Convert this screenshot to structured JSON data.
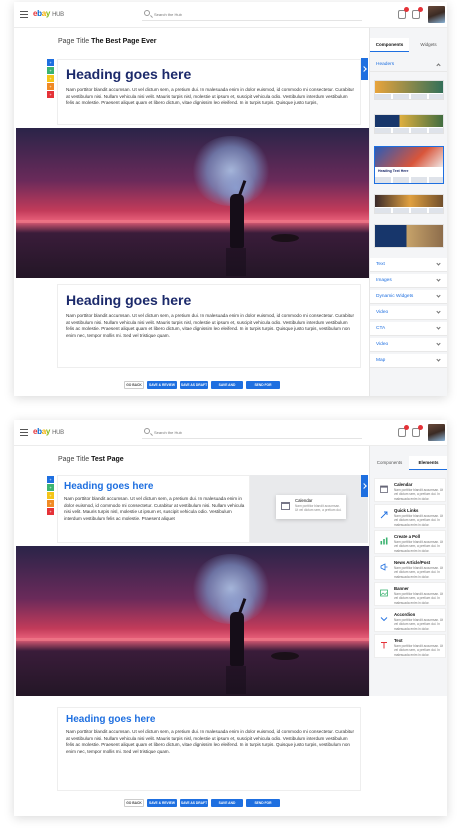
{
  "app": {
    "logo_letters": [
      "e",
      "b",
      "a",
      "y"
    ],
    "logo_suffix": "HUB",
    "search_placeholder": "Search the Hub"
  },
  "screen1": {
    "page_title_prefix": "Page Title",
    "page_title": "The Best Page Ever",
    "heading1": "Heading goes here",
    "para1": "Nam porttitor blandit accumsan. Ut vel dictum sem, a pretium dui. In malesuada enim in dolor euismod, id commodo mi consectetur. Curabitur at vestibulum nisi. Nullam vehicula nisi velit. Mauris turpis nisl, molestie ut ipsum et, suscipit vehicula odio. Vestibulum interdum vestibulum felis ac molestie. Praesent aliquet quam et libero dictum, vitae dignissim leo eleifend. In in turpis turpis. Quisque justo turpis,",
    "heading2": "Heading goes here",
    "para2": "Nam porttitor blandit accumsan. Ut vel dictum sem, a pretium dui. In malesuada enim in dolor euismod, id commodo mi consectetur. Curabitur at vestibulum nisi. Nullam vehicula nisi velit. Mauris turpis nisl, molestie ut ipsum et, suscipit vehicula odio. Vestibulum interdum vestibulum felis ac molestie. Praesent aliquet quam et libero dictum, vitae dignissim leo eleifend. In in turpis turpis. Quisque justo turpis, vestibulum non enim nec, tempor mollis mi. Sed vel tristique quam.",
    "sidebar": {
      "tab_components": "Components",
      "tab_widgets": "Widgets",
      "headers_label": "Headers",
      "thumb_caption": "Heading Text Here",
      "sections": [
        "Text",
        "Images",
        "Dynamic Widgets",
        "Video",
        "CTA",
        "Video",
        "Map"
      ]
    }
  },
  "screen2": {
    "page_title_prefix": "Page Title",
    "page_title": "Test Page",
    "heading1": "Heading goes here",
    "para1": "Nam porttitor blandit accumsan. Ut vel dictum sem, a pretium dui. In malesuada enim in dolor euismod, id commodo mi consectetur. Curabitur at vestibulum nisi. Nullam vehicula nisi velit. Mauris turpis nisl, molestie ut ipsum et, suscipit vehicula odio. Vestibulum interdum vestibulum felis ac molestie. Praesent aliquet",
    "drag_card_title": "Calendar",
    "drag_card_desc": "Nam porttitor blandit accumsan. Ut vel dictum sem, a pretium dui.",
    "heading2": "Heading goes here",
    "para2": "Nam porttitor blandit accumsan. Ut vel dictum sem, a pretium dui. In malesuada enim in dolor euismod, id commodo mi consectetur. Curabitur at vestibulum nisi. Nullam vehicula nisi velit. Mauris turpis nisl, molestie ut ipsum et, suscipit vehicula odio. Vestibulum interdum vestibulum felis ac molestie. Praesent aliquet quam et libero dictum, vitae dignissim leo eleifend. In in turpis turpis. Quisque justo turpis, vestibulum non enim nec, tempor mollis mi. Sed vel tristique quam.",
    "sidebar": {
      "tab_components": "Components",
      "tab_elements": "Elements",
      "items": [
        {
          "title": "Calendar",
          "desc": "Nam porttitor blandit accumsan. Ut vel dictum sem, a pretium dui. In malesuada enim in dolor.",
          "icon": "calendar-icon"
        },
        {
          "title": "Quick Links",
          "desc": "Nam porttitor blandit accumsan. Ut vel dictum sem, a pretium dui. In malesuada enim in dolor.",
          "icon": "link-icon"
        },
        {
          "title": "Create a Poll",
          "desc": "Nam porttitor blandit accumsan. Ut vel dictum sem, a pretium dui. In malesuada enim in dolor.",
          "icon": "poll-icon"
        },
        {
          "title": "News Article/Post",
          "desc": "Nam porttitor blandit accumsan. Ut vel dictum sem, a pretium dui. In malesuada enim in dolor.",
          "icon": "megaphone-icon"
        },
        {
          "title": "Banner",
          "desc": "Nam porttitor blandit accumsan. Ut vel dictum sem, a pretium dui. In malesuada enim in dolor.",
          "icon": "banner-icon"
        },
        {
          "title": "Accordion",
          "desc": "Nam porttitor blandit accumsan. Ut vel dictum sem, a pretium dui. In malesuada enim in dolor.",
          "icon": "accordion-icon"
        },
        {
          "title": "Text",
          "desc": "Nam porttitor blandit accumsan. Ut vel dictum sem, a pretium dui. In malesuada enim in dolor.",
          "icon": "text-icon"
        }
      ]
    }
  },
  "buttons": {
    "back": "GO BACK",
    "review": "SAVE & REVIEW",
    "draft": "SAVE AS DRAFT",
    "publish": "SAVE AND PUBLISH",
    "approval": "SEND FOR APPROVAL"
  },
  "color_tabs": [
    "#1e6fe0",
    "#3cb371",
    "#f5c518",
    "#f08a24",
    "#e53238"
  ],
  "colors": {
    "accent": "#1e6fe0",
    "heading": "#1c2a6b"
  }
}
